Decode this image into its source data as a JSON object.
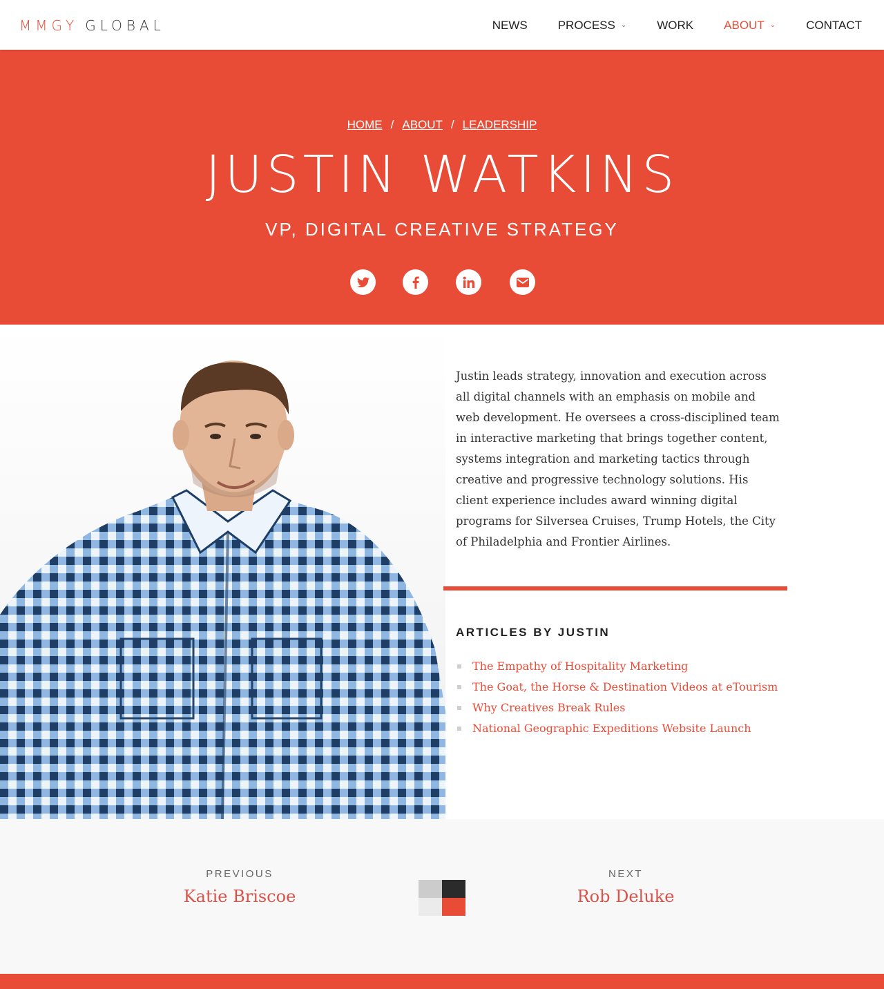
{
  "header": {
    "logo_brand": "MMGY",
    "logo_word": "GLOBAL",
    "nav": [
      {
        "label": "NEWS",
        "has_dropdown": false,
        "active": false
      },
      {
        "label": "PROCESS",
        "has_dropdown": true,
        "active": false
      },
      {
        "label": "WORK",
        "has_dropdown": false,
        "active": false
      },
      {
        "label": "ABOUT",
        "has_dropdown": true,
        "active": true
      },
      {
        "label": "CONTACT",
        "has_dropdown": false,
        "active": false
      }
    ]
  },
  "hero": {
    "breadcrumb": [
      "HOME",
      "ABOUT",
      "LEADERSHIP"
    ],
    "breadcrumb_separator": "/",
    "name": "JUSTIN WATKINS",
    "title": "VP, DIGITAL CREATIVE STRATEGY",
    "socials": [
      "twitter-icon",
      "facebook-icon",
      "linkedin-icon",
      "email-icon"
    ]
  },
  "bio": "Justin leads strategy, innovation and execution across all digital channels with an emphasis on mobile and web development. He oversees a cross-disciplined team in interactive marketing that brings together content, systems integration and marketing tactics through creative and progressive technology solutions. His client experience includes award winning digital programs for Silversea Cruises, Trump Hotels, the City of Philadelphia and Frontier Airlines.",
  "articles": {
    "heading": "ARTICLES BY JUSTIN",
    "items": [
      "The Empathy of Hospitality Marketing",
      "The Goat, the Horse & Destination Videos at eTourism",
      "Why Creatives Break Rules",
      "National Geographic Expeditions Website Launch"
    ]
  },
  "pager": {
    "previous_label": "PREVIOUS",
    "previous_name": "Katie Briscoe",
    "next_label": "NEXT",
    "next_name": "Rob Deluke"
  },
  "colors": {
    "accent": "#e84c37",
    "text": "#222222",
    "pager_bg": "#f8f8f8",
    "grid_icon": [
      "#cccccc",
      "#2b2b2b",
      "#ebebeb",
      "#e84c37"
    ]
  }
}
